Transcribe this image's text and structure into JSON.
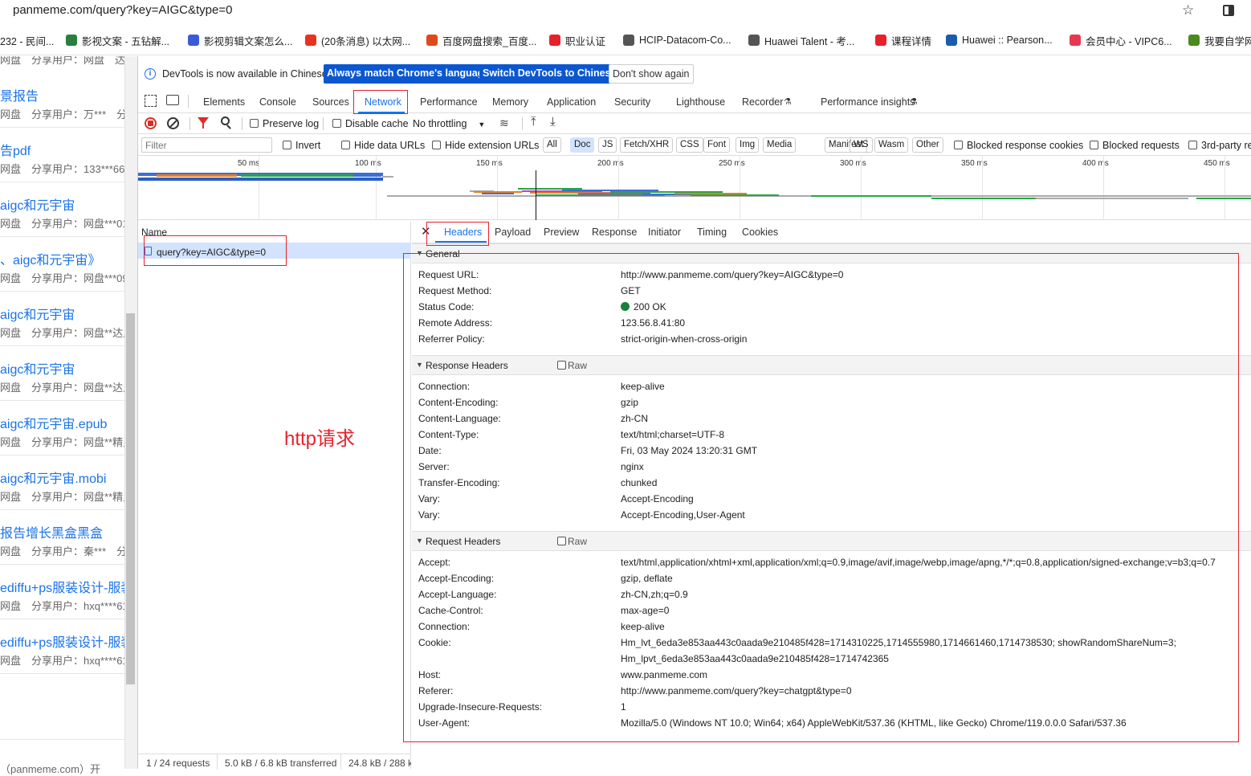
{
  "browser": {
    "url": "panmeme.com/query?key=AIGC&type=0"
  },
  "bookmarks": [
    {
      "label": "232 - 民间...",
      "color": "#ffffff"
    },
    {
      "label": "影视文案 - 五钻解...",
      "color": "#2a7f3e"
    },
    {
      "label": "影视剪辑文案怎么...",
      "color": "#3a5bd9"
    },
    {
      "label": "(20条消息) 以太网...",
      "color": "#e8321f"
    },
    {
      "label": "百度网盘搜索_百度...",
      "color": "#e04a1a"
    },
    {
      "label": "职业认证",
      "color": "#e8202b"
    },
    {
      "label": "HCIP-Datacom-Co...",
      "color": "#555555"
    },
    {
      "label": "Huawei Talent - 考...",
      "color": "#555555"
    },
    {
      "label": "课程详情",
      "color": "#e8202b"
    },
    {
      "label": "Huawei :: Pearson...",
      "color": "#1a5cab"
    },
    {
      "label": "会员中心 - VIPC6...",
      "color": "#e8384f"
    },
    {
      "label": "我要自学网",
      "color": "#4b8a1f"
    }
  ],
  "left_page": {
    "items": [
      {
        "title": "景报告",
        "sub": "网盘　分享用户：万***　分享"
      },
      {
        "title": "告pdf",
        "sub": "网盘　分享用户：133***66"
      },
      {
        "title": "aigc和元宇宙",
        "sub": "网盘　分享用户：网盘***01"
      },
      {
        "title": "、aigc和元宇宙》",
        "sub": "网盘　分享用户：网盘***09"
      },
      {
        "title": "aigc和元宇宙",
        "sub": "网盘　分享用户：网盘**达人"
      },
      {
        "title": "aigc和元宇宙",
        "sub": "网盘　分享用户：网盘**达人"
      },
      {
        "title": "aigc和元宇宙.epub",
        "sub": "网盘　分享用户：网盘**精灵"
      },
      {
        "title": "aigc和元宇宙.mobi",
        "sub": "网盘　分享用户：网盘**精灵"
      },
      {
        "title": "报告增长黑盒黑盒",
        "sub": "网盘　分享用户：秦***　分"
      },
      {
        "title": "ediffu+ps服装设计-服装",
        "sub": "网盘　分享用户：hxq****61"
      },
      {
        "title": "ediffu+ps服装设计-服装",
        "sub": "网盘　分享用户：hxq****61"
      }
    ],
    "top_sub": "网盘　分享用户：网盘　达人",
    "footer": "（panmeme.com）开"
  },
  "devtools": {
    "info_text": "DevTools is now available in Chinese!",
    "btn_match": "Always match Chrome's language",
    "btn_switch": "Switch DevTools to Chinese",
    "btn_dont": "Don't show again",
    "tabs": [
      "Elements",
      "Console",
      "Sources",
      "Network",
      "Performance",
      "Memory",
      "Application",
      "Security",
      "Lighthouse",
      "Recorder",
      "Performance insights"
    ],
    "toolbar": {
      "preserve": "Preserve log",
      "disable": "Disable cache",
      "throttle": "No throttling"
    },
    "filter": {
      "placeholder": "Filter",
      "invert": "Invert",
      "hide_data": "Hide data URLs",
      "hide_ext": "Hide extension URLs",
      "chips": [
        "All",
        "Doc",
        "JS",
        "Fetch/XHR",
        "CSS",
        "Font",
        "Img",
        "Media",
        "Manifest",
        "WS",
        "Wasm",
        "Other"
      ],
      "blocked_cookies": "Blocked response cookies",
      "blocked_req": "Blocked requests",
      "third": "3rd-party re"
    },
    "timeline_ticks": [
      "50 ms",
      "100 ms",
      "150 ms",
      "200 ms",
      "250 ms",
      "300 ms",
      "350 ms",
      "400 ms",
      "450 ms"
    ],
    "name_header": "Name",
    "request": "query?key=AIGC&type=0",
    "status": [
      "1 / 24 requests",
      "5.0 kB / 6.8 kB transferred",
      "24.8 kB / 288 k"
    ],
    "detail_tabs": [
      "Headers",
      "Payload",
      "Preview",
      "Response",
      "Initiator",
      "Timing",
      "Cookies"
    ],
    "general": {
      "title": "General",
      "rows": [
        [
          "Request URL:",
          "http://www.panmeme.com/query?key=AIGC&type=0"
        ],
        [
          "Request Method:",
          "GET"
        ],
        [
          "Status Code:",
          "200 OK"
        ],
        [
          "Remote Address:",
          "123.56.8.41:80"
        ],
        [
          "Referrer Policy:",
          "strict-origin-when-cross-origin"
        ]
      ]
    },
    "response": {
      "title": "Response Headers",
      "raw": "Raw",
      "rows": [
        [
          "Connection:",
          "keep-alive"
        ],
        [
          "Content-Encoding:",
          "gzip"
        ],
        [
          "Content-Language:",
          "zh-CN"
        ],
        [
          "Content-Type:",
          "text/html;charset=UTF-8"
        ],
        [
          "Date:",
          "Fri, 03 May 2024 13:20:31 GMT"
        ],
        [
          "Server:",
          "nginx"
        ],
        [
          "Transfer-Encoding:",
          "chunked"
        ],
        [
          "Vary:",
          "Accept-Encoding"
        ],
        [
          "Vary:",
          "Accept-Encoding,User-Agent"
        ]
      ]
    },
    "request_headers": {
      "title": "Request Headers",
      "raw": "Raw",
      "rows": [
        [
          "Accept:",
          "text/html,application/xhtml+xml,application/xml;q=0.9,image/avif,image/webp,image/apng,*/*;q=0.8,application/signed-exchange;v=b3;q=0.7"
        ],
        [
          "Accept-Encoding:",
          "gzip, deflate"
        ],
        [
          "Accept-Language:",
          "zh-CN,zh;q=0.9"
        ],
        [
          "Cache-Control:",
          "max-age=0"
        ],
        [
          "Connection:",
          "keep-alive"
        ],
        [
          "Cookie:",
          "Hm_lvt_6eda3e853aa443c0aada9e210485f428=1714310225,1714555980,1714661460,1714738530; showRandomShareNum=3;"
        ],
        [
          "",
          "Hm_lpvt_6eda3e853aa443c0aada9e210485f428=1714742365"
        ],
        [
          "Host:",
          "www.panmeme.com"
        ],
        [
          "Referer:",
          "http://www.panmeme.com/query?key=chatgpt&type=0"
        ],
        [
          "Upgrade-Insecure-Requests:",
          "1"
        ],
        [
          "User-Agent:",
          "Mozilla/5.0 (Windows NT 10.0; Win64; x64) AppleWebKit/537.36 (KHTML, like Gecko) Chrome/119.0.0.0 Safari/537.36"
        ]
      ]
    }
  },
  "annotation": "http请求",
  "colors": {
    "accent": "#1a73e8",
    "status_ok": "#188038",
    "annotation_red": "#e8212b"
  }
}
